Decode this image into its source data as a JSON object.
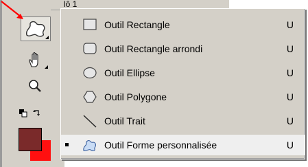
{
  "header": {
    "partial_label": "lô 1"
  },
  "toolbar": {
    "active_tool_icon": "custom-shape-icon",
    "tools": [
      {
        "name": "hand-tool",
        "icon": "hand-icon"
      },
      {
        "name": "zoom-tool",
        "icon": "magnifier-icon"
      }
    ],
    "foreground_color": "#7a2a2a",
    "background_color": "#ff1010"
  },
  "menu": {
    "items": [
      {
        "label": "Outil Rectangle",
        "shortcut": "U",
        "icon": "rectangle-icon",
        "selected": false
      },
      {
        "label": "Outil Rectangle arrondi",
        "shortcut": "U",
        "icon": "rounded-rectangle-icon",
        "selected": false
      },
      {
        "label": "Outil Ellipse",
        "shortcut": "U",
        "icon": "ellipse-icon",
        "selected": false
      },
      {
        "label": "Outil Polygone",
        "shortcut": "U",
        "icon": "polygon-icon",
        "selected": false
      },
      {
        "label": "Outil Trait",
        "shortcut": "U",
        "icon": "line-icon",
        "selected": false
      },
      {
        "label": "Outil Forme personnalisée",
        "shortcut": "U",
        "icon": "custom-shape-icon",
        "selected": true
      }
    ]
  }
}
